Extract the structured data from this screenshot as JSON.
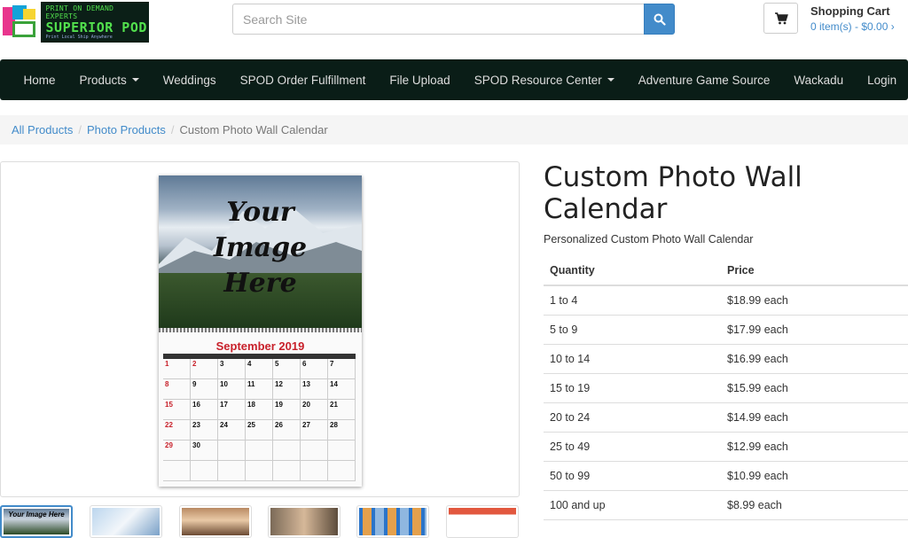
{
  "logo": {
    "line1": "PRINT ON DEMAND EXPERTS",
    "line2": "SUPERIOR POD",
    "line3": "Print Local   Ship Anywhere"
  },
  "search": {
    "placeholder": "Search Site",
    "icon": "search-icon"
  },
  "cart": {
    "title": "Shopping Cart",
    "summary": "0 item(s) - $0.00 ›",
    "icon": "shopping-cart-icon"
  },
  "nav": {
    "home": "Home",
    "products": "Products",
    "weddings": "Weddings",
    "fulfillment": "SPOD Order Fulfillment",
    "upload": "File Upload",
    "resource": "SPOD Resource Center",
    "adventure": "Adventure Game Source",
    "wackadu": "Wackadu",
    "login": "Login"
  },
  "breadcrumb": {
    "all": "All Products",
    "photo": "Photo Products",
    "current": "Custom Photo Wall Calendar"
  },
  "product_image": {
    "overlay_line1": "Your",
    "overlay_line2": "Image",
    "overlay_line3": "Here",
    "month": "September 2019",
    "days": [
      "1",
      "2",
      "3",
      "4",
      "5",
      "6",
      "7",
      "8",
      "9",
      "10",
      "11",
      "12",
      "13",
      "14",
      "15",
      "16",
      "17",
      "18",
      "19",
      "20",
      "21",
      "22",
      "23",
      "24",
      "25",
      "26",
      "27",
      "28",
      "29",
      "30"
    ]
  },
  "thumbnails": {
    "first_label": "Your Image Here"
  },
  "product": {
    "title": "Custom Photo Wall Calendar",
    "subtitle": "Personalized Custom Photo Wall Calendar"
  },
  "pricing": {
    "qty_header": "Quantity",
    "price_header": "Price",
    "rows": [
      {
        "qty": "1 to 4",
        "price": "$18.99 each"
      },
      {
        "qty": "5 to 9",
        "price": "$17.99 each"
      },
      {
        "qty": "10 to 14",
        "price": "$16.99 each"
      },
      {
        "qty": "15 to 19",
        "price": "$15.99 each"
      },
      {
        "qty": "20 to 24",
        "price": "$14.99 each"
      },
      {
        "qty": "25 to 49",
        "price": "$12.99 each"
      },
      {
        "qty": "50 to 99",
        "price": "$10.99 each"
      },
      {
        "qty": "100 and up",
        "price": "$8.99 each"
      }
    ]
  },
  "colors": {
    "nav_bg": "#0a1d17",
    "link": "#428bca",
    "calendar_red": "#c8212b"
  }
}
